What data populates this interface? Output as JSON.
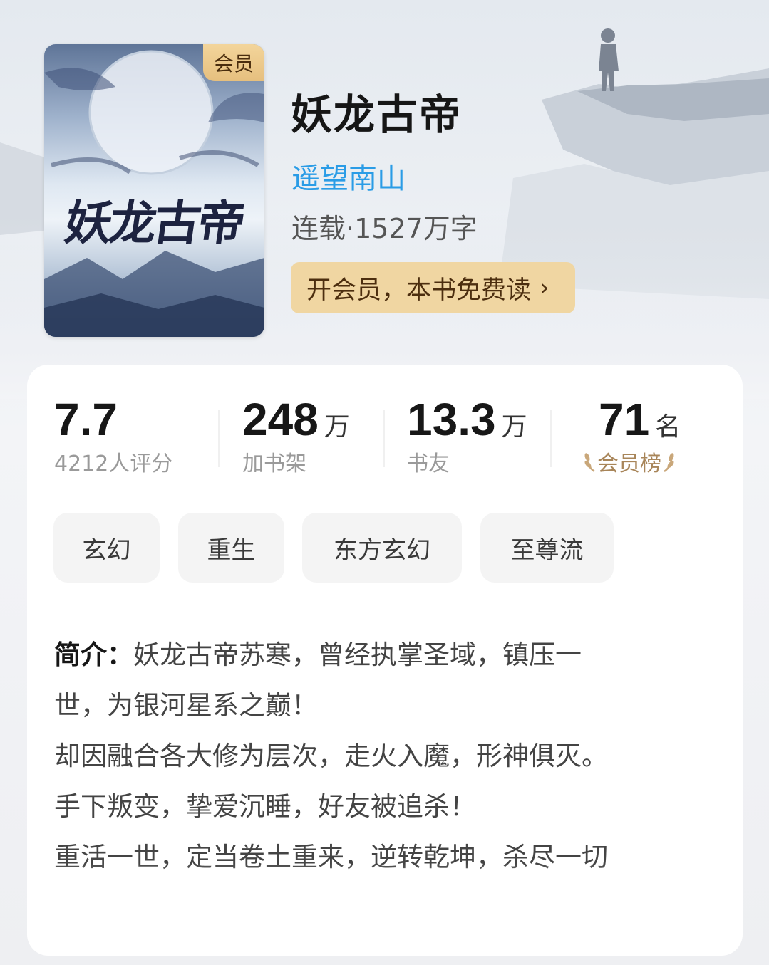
{
  "book": {
    "badge": "会员",
    "cover_title": "妖龙古帝",
    "title": "妖龙古帝",
    "author": "遥望南山",
    "meta": "连载·1527万字",
    "vip_button": "开会员，本书免费读",
    "vip_button_chevron": "›"
  },
  "stats": [
    {
      "value": "7.7",
      "unit": "",
      "label": "4212人评分"
    },
    {
      "value": "248",
      "unit": "万",
      "label": "加书架"
    },
    {
      "value": "13.3",
      "unit": "万",
      "label": "书友"
    },
    {
      "value": "71",
      "unit": "名",
      "label": "会员榜"
    }
  ],
  "tags": [
    "玄幻",
    "重生",
    "东方玄幻",
    "至尊流"
  ],
  "intro": {
    "label": "简介：",
    "lines": [
      "妖龙古帝苏寒，曾经执掌圣域，镇压一",
      "世，为银河星系之巅！",
      "却因融合各大修为层次，走火入魔，形神俱灭。",
      "手下叛变，挚爱沉睡，好友被追杀！",
      "重活一世，定当卷土重来，逆转乾坤，杀尽一切"
    ]
  },
  "colors": {
    "author": "#2a9ce6",
    "vip_button_bg": "#f0d6a2",
    "rank_label": "#a88559"
  }
}
